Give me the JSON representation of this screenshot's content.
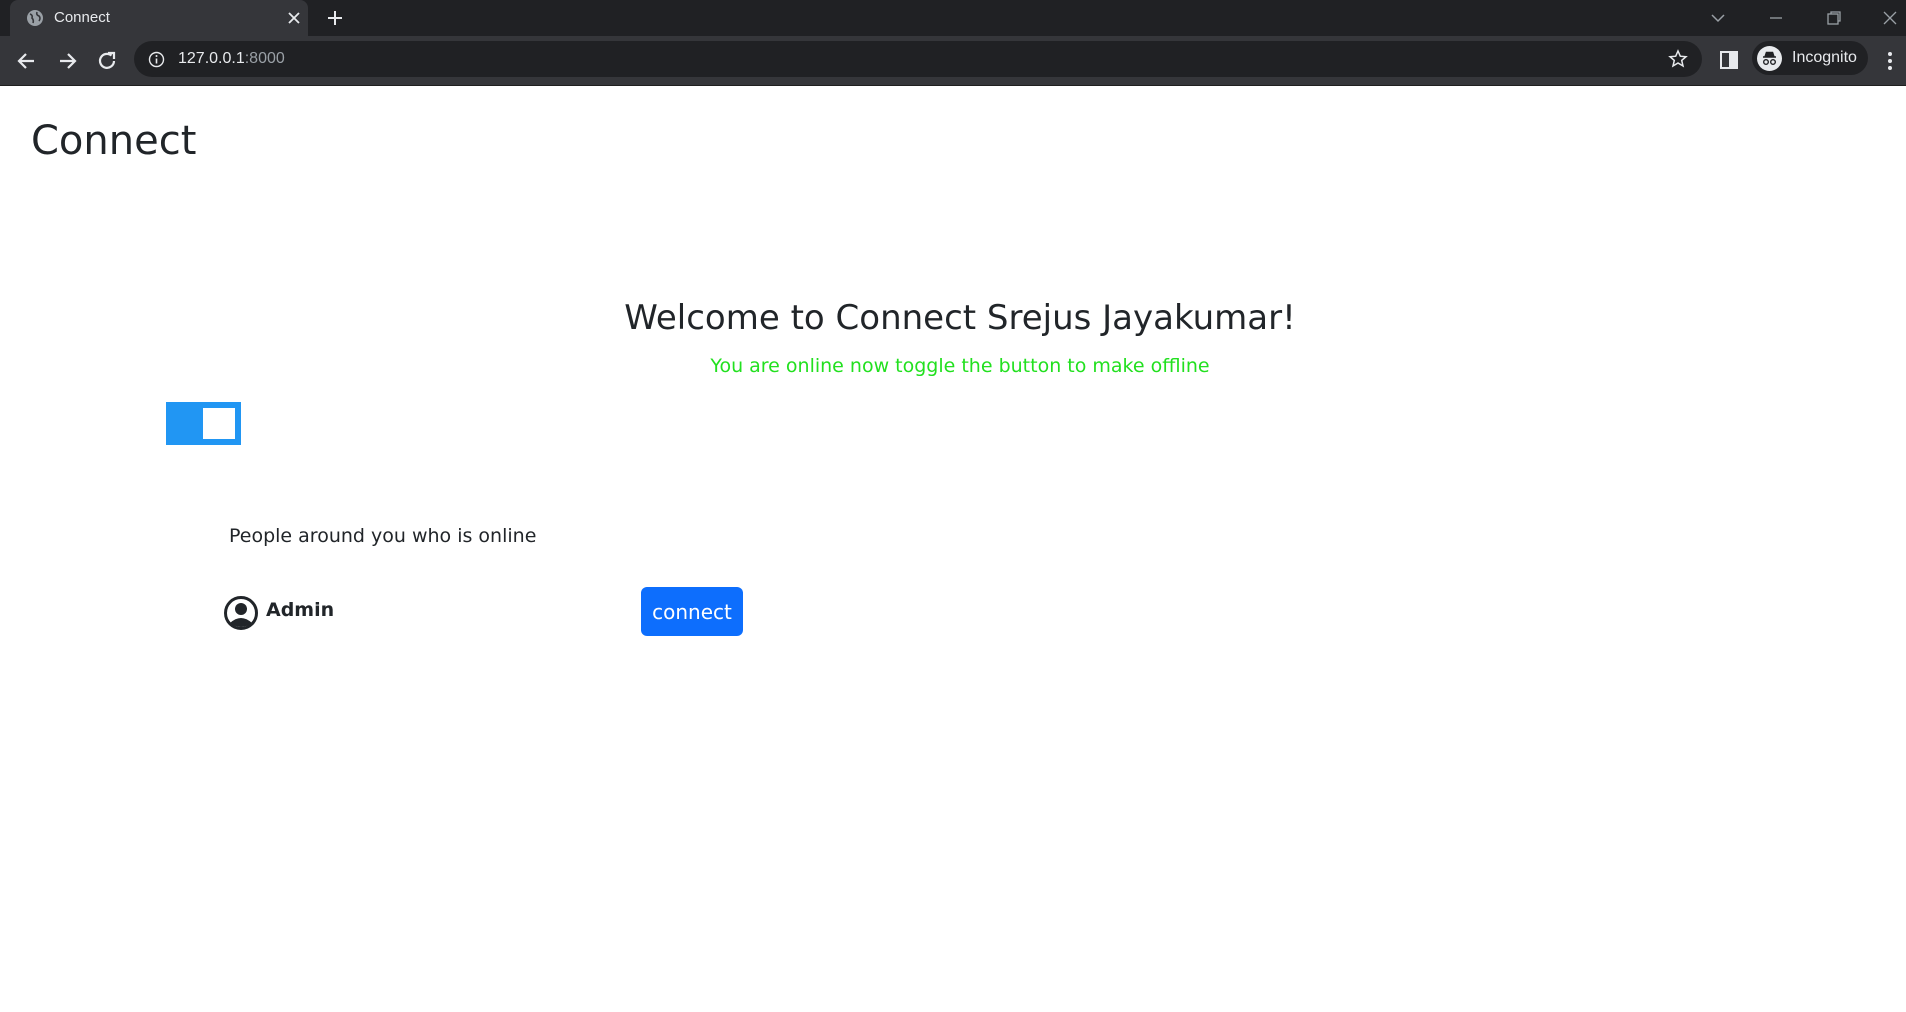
{
  "browser": {
    "tab_title": "Connect",
    "url_host": "127.0.0.1",
    "url_port": ":8000",
    "profile_label": "Incognito"
  },
  "page": {
    "brand": "Connect",
    "welcome": "Welcome to Connect Srejus Jayakumar!",
    "status_text": "You are online now toggle the button to make offline",
    "status_color": "#22e01f",
    "toggle_on": true,
    "people_title": "People around you who is online",
    "people": [
      {
        "name": "Admin",
        "action_label": "connect"
      }
    ]
  },
  "colors": {
    "toggle_accent": "#2196f3",
    "button_accent": "#0d6efd"
  }
}
